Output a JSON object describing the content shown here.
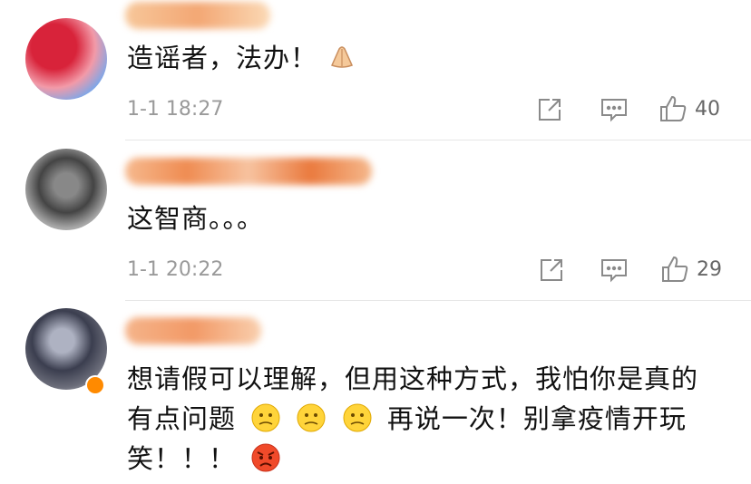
{
  "comments": [
    {
      "text_lines": [
        "造谣者，法办！"
      ],
      "time": "1-1 18:27",
      "likes": "40",
      "avatar_colors": [
        "#d8233a",
        "#f29aa8",
        "#6fa8f0"
      ]
    },
    {
      "text_lines": [
        "这智商。。。"
      ],
      "time": "1-1 20:22",
      "likes": "29",
      "avatar_colors": [
        "#777777",
        "#333333",
        "#bbbbbb"
      ]
    },
    {
      "text_lines": [
        "想请假可以理解，但用这种方式，我怕你是真的",
        "有点问题",
        "再说一次！别拿疫情开玩",
        "笑！！！"
      ],
      "avatar_colors": [
        "#3b3e4f",
        "#9ca0b0",
        "#6b6d7a"
      ]
    }
  ],
  "colors": {
    "accent_orange": "#f0a060",
    "icon_gray": "#8a8a8a"
  },
  "icons": [
    "share-icon",
    "comment-icon",
    "like-icon"
  ]
}
